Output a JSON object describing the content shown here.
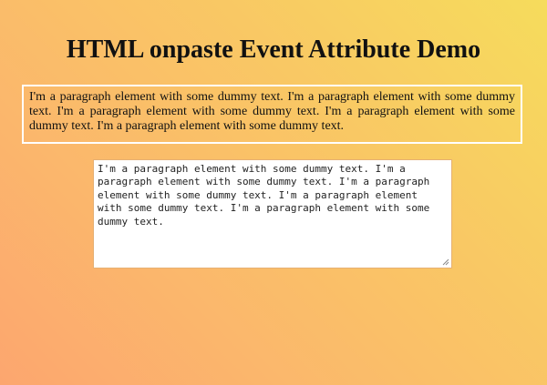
{
  "page": {
    "title": "HTML onpaste Event Attribute Demo"
  },
  "paragraph": {
    "text": "I'm a paragraph element with some dummy text. I'm a paragraph element with some dummy text. I'm a paragraph element with some dummy text. I'm a paragraph element with some dummy text. I'm a paragraph element with some dummy text."
  },
  "textarea": {
    "value": "I'm a paragraph element with some dummy text. I'm a paragraph element with some dummy text. I'm a paragraph element with some dummy text. I'm a paragraph element with some dummy text. I'm a paragraph element with some dummy text."
  },
  "colors": {
    "background_start": "#f6dc5c",
    "background_end": "#fca66f",
    "paragraph_border": "#ffffff",
    "textarea_border": "#e6b073"
  },
  "icons": {
    "resize_grip": "resize-grip-icon"
  }
}
